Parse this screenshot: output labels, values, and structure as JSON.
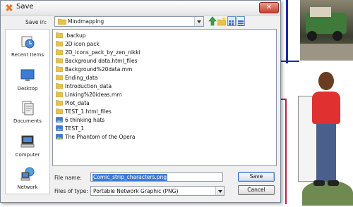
{
  "window": {
    "title": "Save",
    "close_glyph": "✕"
  },
  "toolbar": {
    "save_in_label": "Save in:",
    "save_in_value": "Mindmapping",
    "icons": [
      "up-folder-icon",
      "new-folder-icon",
      "list-view-icon",
      "details-view-icon"
    ]
  },
  "places": [
    {
      "label": "Recent Items",
      "icon": "recent-items-icon"
    },
    {
      "label": "Desktop",
      "icon": "desktop-icon"
    },
    {
      "label": "Documents",
      "icon": "documents-icon"
    },
    {
      "label": "Computer",
      "icon": "computer-icon"
    },
    {
      "label": "Network",
      "icon": "network-icon"
    }
  ],
  "files": [
    {
      "name": ".backup",
      "type": "folder"
    },
    {
      "name": "2D icon pack",
      "type": "folder"
    },
    {
      "name": "2D_icons_pack_by_zen_nikki",
      "type": "folder"
    },
    {
      "name": "Background data.html_files",
      "type": "folder"
    },
    {
      "name": "Background%20data.mm",
      "type": "folder"
    },
    {
      "name": "Ending_data",
      "type": "folder"
    },
    {
      "name": "Introduction_data",
      "type": "folder"
    },
    {
      "name": "Linking%20ideas.mm",
      "type": "folder"
    },
    {
      "name": "Plot_data",
      "type": "folder"
    },
    {
      "name": "TEST_1.html_files",
      "type": "folder"
    },
    {
      "name": "6 thinking hats",
      "type": "image"
    },
    {
      "name": "TEST_1",
      "type": "image"
    },
    {
      "name": "The Phantom of the Opera",
      "type": "image"
    }
  ],
  "form": {
    "file_name_label": "File name:",
    "file_name_value": "Comic_strip_characters.png",
    "file_type_label": "Files of type:",
    "file_type_value": "Portable Network Graphic (PNG)"
  },
  "buttons": {
    "save": "Save",
    "cancel": "Cancel"
  },
  "colors": {
    "accent": "#3d7bd6",
    "folder": "#e8c24a",
    "close": "#c6412e"
  }
}
